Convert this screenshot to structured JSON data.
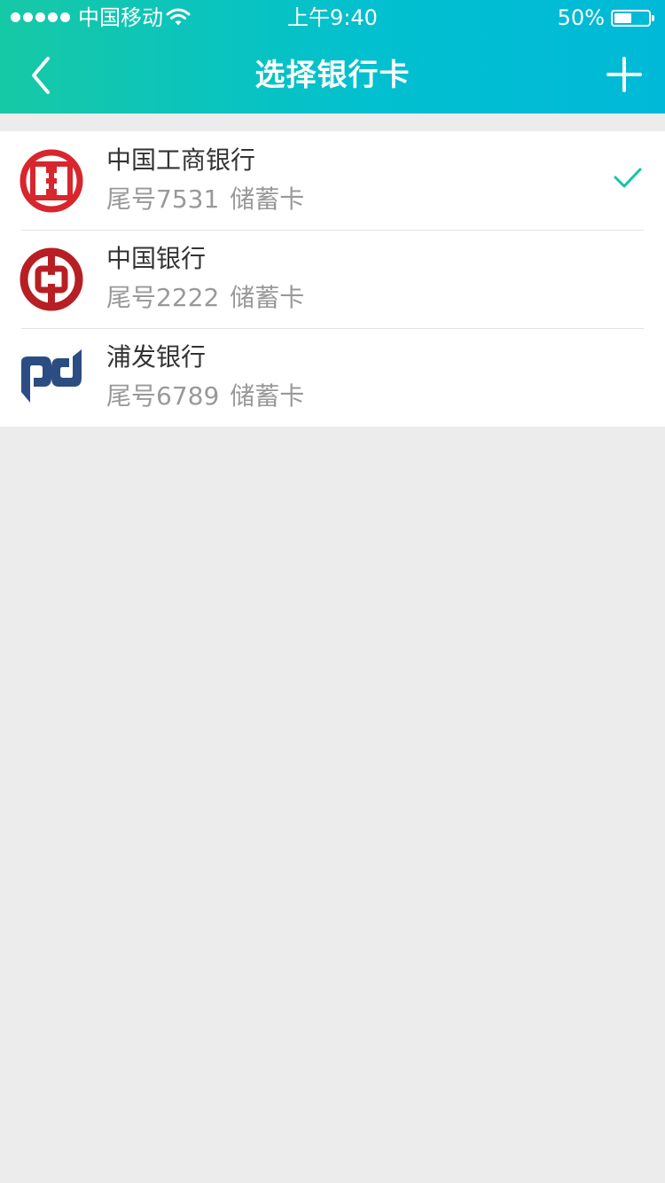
{
  "status_bar": {
    "carrier": "中国移动",
    "time": "上午9:40",
    "battery_percent": "50%",
    "battery_level": 0.5,
    "signal_dots": 5
  },
  "nav": {
    "title": "选择银行卡",
    "back_icon": "chevron-left-icon",
    "add_icon": "plus-icon"
  },
  "cards": [
    {
      "bank": "中国工商银行",
      "tail": "尾号7531",
      "type": "储蓄卡",
      "logo": "icbc-logo",
      "selected": true
    },
    {
      "bank": "中国银行",
      "tail": "尾号2222",
      "type": "储蓄卡",
      "logo": "boc-logo",
      "selected": false
    },
    {
      "bank": "浦发银行",
      "tail": "尾号6789",
      "type": "储蓄卡",
      "logo": "spdb-logo",
      "selected": false
    }
  ],
  "colors": {
    "header_gradient_start": "#16c9a5",
    "header_gradient_end": "#00b9d8",
    "check": "#17c3a6",
    "icbc_red": "#d7262d",
    "boc_red": "#b71f24",
    "spdb_blue": "#2b4d82"
  }
}
